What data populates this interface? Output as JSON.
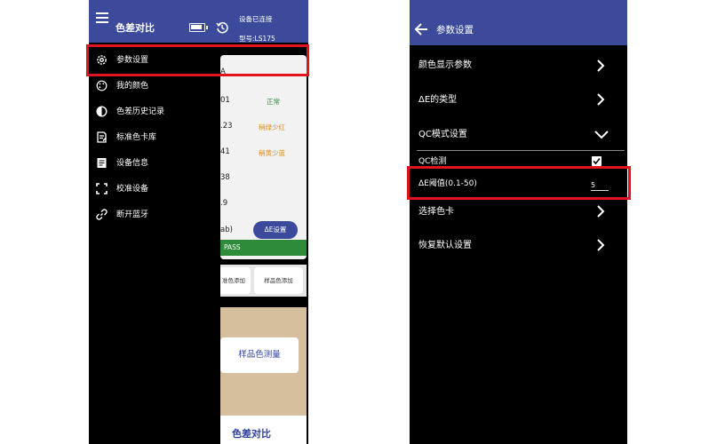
{
  "left": {
    "header": {
      "title": "色差对比",
      "status": "设备已连接",
      "model": "型号:LS175"
    },
    "drawer": {
      "items": [
        {
          "label": "参数设置",
          "icon": "gear-icon"
        },
        {
          "label": "我的颜色",
          "icon": "palette-icon"
        },
        {
          "label": "色差历史记录",
          "icon": "half-circle-icon"
        },
        {
          "label": "标准色卡库",
          "icon": "document-edit-icon"
        },
        {
          "label": "设备信息",
          "icon": "info-document-icon"
        },
        {
          "label": "校准设备",
          "icon": "corners-frame-icon"
        },
        {
          "label": "断开蓝牙",
          "icon": "link-icon"
        }
      ]
    },
    "background": {
      "rows": [
        {
          "value": "A",
          "tag": "",
          "tag_color": ""
        },
        {
          "value": "01",
          "tag": "正常",
          "tag_color": "#2e8b3a"
        },
        {
          "value": ".23",
          "tag": "稍绿少红",
          "tag_color": "#e08a1e"
        },
        {
          "value": "41",
          "tag": "稍黄少蓝",
          "tag_color": "#e08a1e"
        },
        {
          "value": "38",
          "tag": "",
          "tag_color": ""
        },
        {
          "value": ".9",
          "tag": "",
          "tag_color": ""
        },
        {
          "value": "ab)",
          "tag": "",
          "tag_color": ""
        }
      ],
      "de_button": "ΔE设置",
      "pass": "PASS",
      "btn_add_standard": "准色添加",
      "btn_add_sample": "样品色添加",
      "measure_button": "样品色测量",
      "bottom_title": "色差对比"
    }
  },
  "right": {
    "header": {
      "title": "参数设置"
    },
    "items": [
      {
        "label": "颜色显示参数",
        "control": "chevron-right"
      },
      {
        "label": "ΔE的类型",
        "control": "chevron-right"
      },
      {
        "label": "QC模式设置",
        "control": "chevron-down"
      },
      {
        "label": "QC检测",
        "control": "checkbox"
      },
      {
        "label": "ΔE阈值(0.1-50)",
        "control": "input"
      },
      {
        "label": "选择色卡",
        "control": "chevron-right"
      },
      {
        "label": "恢复默认设置",
        "control": "chevron-right"
      }
    ],
    "qc_checked": true,
    "threshold_value": "5"
  },
  "colors": {
    "header_blue": "#3b4a9b",
    "highlight_red": "#e0141e",
    "pass_green": "#2e8b3a",
    "warning_orange": "#e08a1e"
  }
}
